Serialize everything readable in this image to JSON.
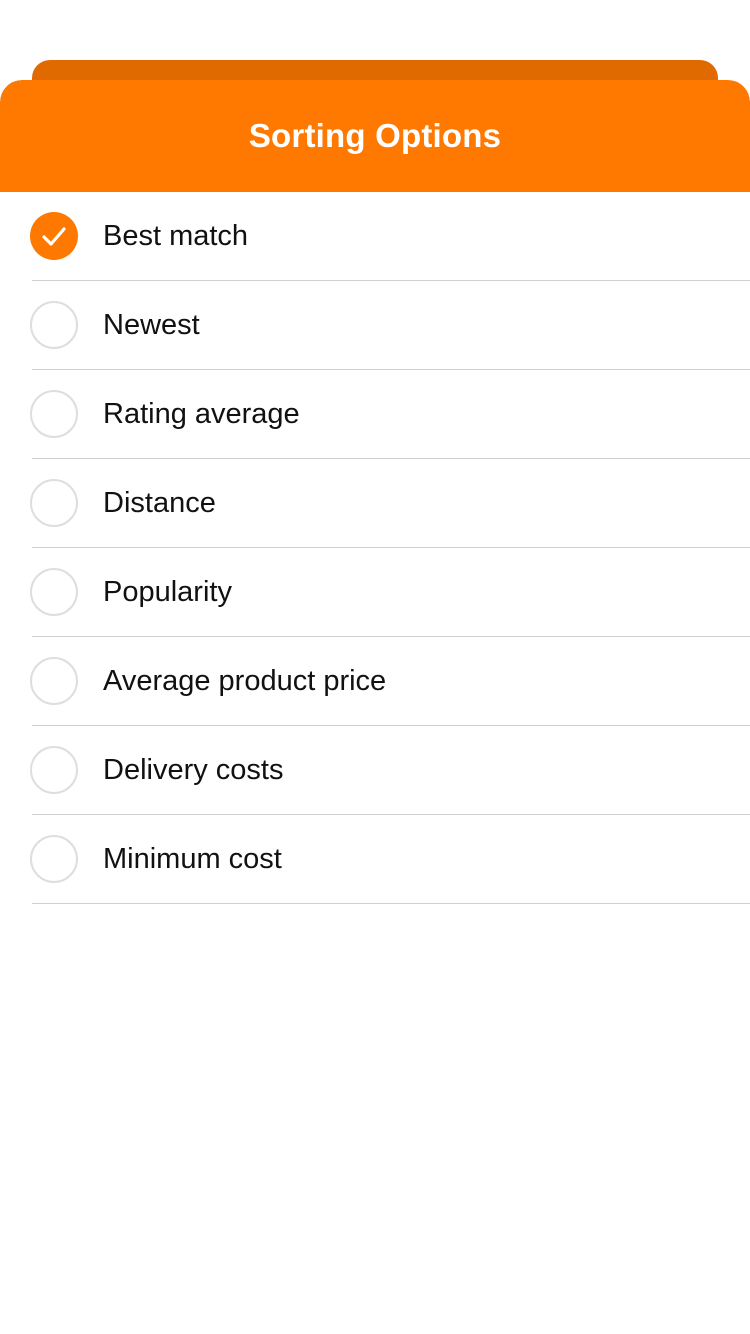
{
  "colors": {
    "accent": "#FF7800",
    "accent_dark": "#E06A00"
  },
  "sheet": {
    "title": "Sorting Options"
  },
  "options": [
    {
      "label": "Best match",
      "selected": true
    },
    {
      "label": "Newest",
      "selected": false
    },
    {
      "label": "Rating average",
      "selected": false
    },
    {
      "label": "Distance",
      "selected": false
    },
    {
      "label": "Popularity",
      "selected": false
    },
    {
      "label": "Average product price",
      "selected": false
    },
    {
      "label": "Delivery costs",
      "selected": false
    },
    {
      "label": "Minimum cost",
      "selected": false
    }
  ],
  "icons": {
    "selected": "checkmark-icon",
    "unselected": "radio-empty-icon"
  }
}
